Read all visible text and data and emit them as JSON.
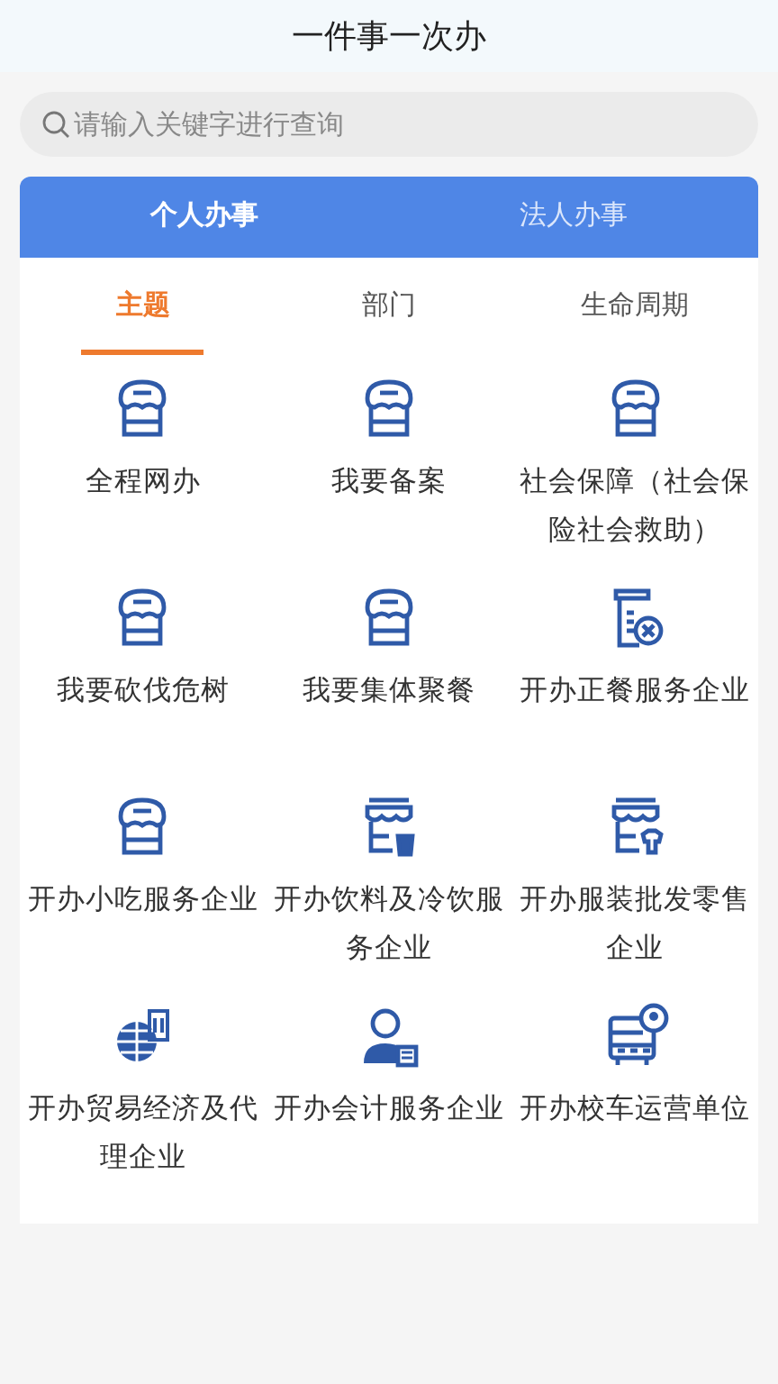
{
  "header": {
    "title": "一件事一次办"
  },
  "search": {
    "placeholder": "请输入关键字进行查询"
  },
  "main_tabs": [
    {
      "label": "个人办事",
      "selected": true
    },
    {
      "label": "法人办事",
      "selected": false
    }
  ],
  "sub_tabs": [
    {
      "label": "主题",
      "selected": true
    },
    {
      "label": "部门",
      "selected": false
    },
    {
      "label": "生命周期",
      "selected": false
    }
  ],
  "services": [
    {
      "label": "全程网办",
      "kind": "shop"
    },
    {
      "label": "我要备案",
      "kind": "shop"
    },
    {
      "label": "社会保障（社会保险社会救助）",
      "kind": "shop"
    },
    {
      "label": "我要砍伐危树",
      "kind": "shop"
    },
    {
      "label": "我要集体聚餐",
      "kind": "shop"
    },
    {
      "label": "开办正餐服务企业",
      "kind": "receipt"
    },
    {
      "label": "开办小吃服务企业",
      "kind": "shop"
    },
    {
      "label": "开办饮料及冷饮服务企业",
      "kind": "drink-shop"
    },
    {
      "label": "开办服装批发零售企业",
      "kind": "clothes-shop"
    },
    {
      "label": "开办贸易经济及代理企业",
      "kind": "globe"
    },
    {
      "label": "开办会计服务企业",
      "kind": "accountant"
    },
    {
      "label": "开办校车运营单位",
      "kind": "bus"
    }
  ]
}
